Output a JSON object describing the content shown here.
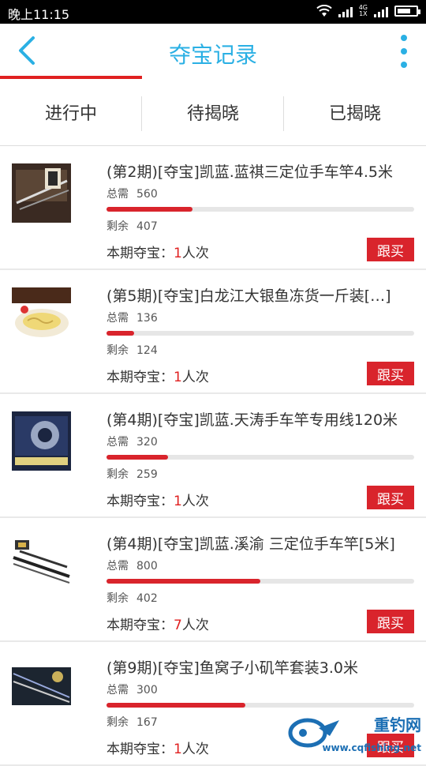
{
  "status": {
    "time": "晚上11:15",
    "network": "4G\n1X"
  },
  "header": {
    "title": "夺宝记录"
  },
  "tabs": [
    "进行中",
    "待揭晓",
    "已揭晓"
  ],
  "labels": {
    "need": "总需",
    "remain": "剩余",
    "period": "本期夺宝：",
    "unit": "人次",
    "follow": "跟买"
  },
  "items": [
    {
      "name": "(第2期)[夺宝]凯蓝.蓝祺三定位手车竿4.5米",
      "total": "560",
      "remain": "407",
      "count": "1",
      "progress": 0.28,
      "thumb_icon": "fishing-rod-box-icon"
    },
    {
      "name": "(第5期)[夺宝]白龙江大银鱼冻货一斤装[…]",
      "total": "136",
      "remain": "124",
      "count": "1",
      "progress": 0.09,
      "thumb_icon": "silverfish-plate-icon"
    },
    {
      "name": "(第4期)[夺宝]凯蓝.天涛手车竿专用线120米",
      "total": "320",
      "remain": "259",
      "count": "1",
      "progress": 0.2,
      "thumb_icon": "fishing-line-spool-icon"
    },
    {
      "name": "(第4期)[夺宝]凯蓝.溪渝 三定位手车竿[5米]",
      "total": "800",
      "remain": "402",
      "count": "7",
      "progress": 0.5,
      "thumb_icon": "fishing-rod-icon"
    },
    {
      "name": "(第9期)[夺宝]鱼窝子小矶竿套装3.0米",
      "total": "300",
      "remain": "167",
      "count": "1",
      "progress": 0.45,
      "thumb_icon": "rod-set-icon"
    }
  ],
  "watermark": {
    "brand": "重钓网",
    "url": "www.cqfishing.net"
  },
  "colors": {
    "accent": "#2bb0e4",
    "red": "#d9242c"
  }
}
